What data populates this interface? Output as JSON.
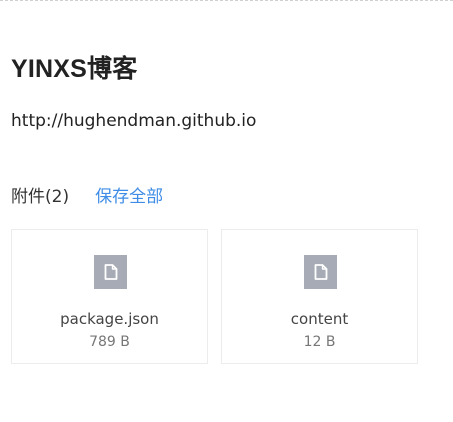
{
  "blog": {
    "title": "YINXS博客",
    "url": "http://hughendman.github.io"
  },
  "attachments": {
    "count_label": "附件(2)",
    "save_all_label": "保存全部",
    "files": [
      {
        "name": "package.json",
        "size": "789 B",
        "icon": "file-icon"
      },
      {
        "name": "content",
        "size": "12 B",
        "icon": "file-icon"
      }
    ]
  },
  "colors": {
    "link": "#3e8ce6",
    "icon_bg": "#a7abb6",
    "card_border": "#ececec"
  }
}
